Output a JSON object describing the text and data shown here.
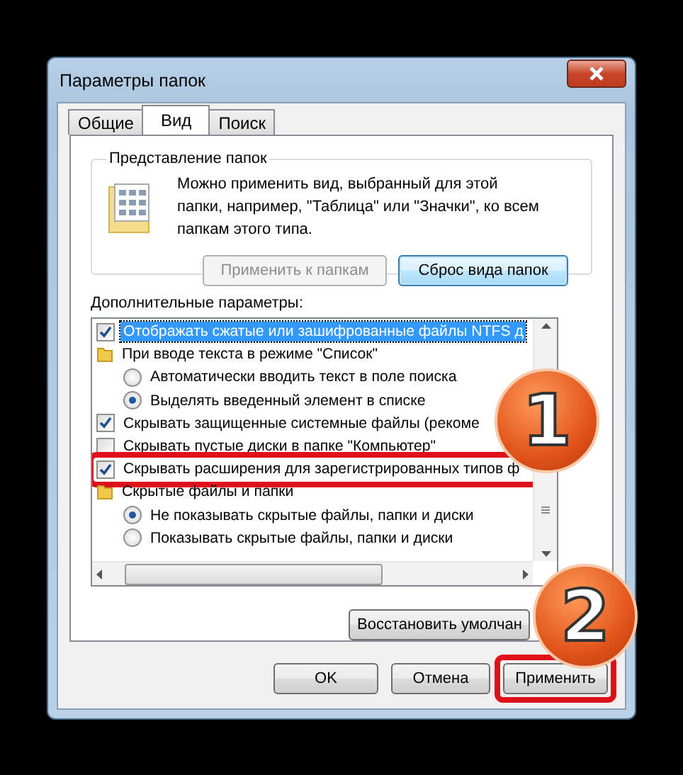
{
  "window": {
    "title": "Параметры папок"
  },
  "tabs": [
    {
      "label": "Общие",
      "selected": false
    },
    {
      "label": "Вид",
      "selected": true
    },
    {
      "label": "Поиск",
      "selected": false
    }
  ],
  "folder_views": {
    "title": "Представление папок",
    "description": "Можно применить вид, выбранный для этой папки, например, \"Таблица\" или \"Значки\", ко всем папкам этого типа.",
    "buttons": [
      {
        "label": "Применить к папкам",
        "disabled": true,
        "focused": false
      },
      {
        "label": "Сброс вида папок",
        "disabled": false,
        "focused": true
      }
    ]
  },
  "advanced": {
    "label": "Дополнительные параметры:",
    "items": [
      {
        "kind": "checkbox",
        "label": "Отображать сжатые или зашифрованные файлы NTFS д",
        "checked": true,
        "selected": true,
        "outlined": false
      },
      {
        "kind": "folder",
        "label": "При вводе текста в режиме \"Список\"",
        "selected": false,
        "outlined": false,
        "children": [
          {
            "kind": "radio",
            "label": "Автоматически вводить текст в поле поиска",
            "checked": false,
            "selected": false,
            "outlined": false
          },
          {
            "kind": "radio",
            "label": "Выделять введенный элемент в списке",
            "checked": true,
            "selected": false,
            "outlined": false
          }
        ]
      },
      {
        "kind": "checkbox",
        "label": "Скрывать защищенные системные файлы (рекоме",
        "checked": true,
        "selected": false,
        "outlined": false
      },
      {
        "kind": "checkbox",
        "label": "Скрывать пустые диски в папке \"Компьютер\"",
        "checked": false,
        "selected": false,
        "outlined": false
      },
      {
        "kind": "checkbox",
        "label": "Скрывать расширения для зарегистрированных типов ф",
        "checked": true,
        "selected": false,
        "outlined": true
      },
      {
        "kind": "folder",
        "label": "Скрытые файлы и папки",
        "selected": false,
        "outlined": false,
        "children": [
          {
            "kind": "radio",
            "label": "Не показывать скрытые файлы, папки и диски",
            "checked": true,
            "selected": false,
            "outlined": false
          },
          {
            "kind": "radio",
            "label": "Показывать скрытые файлы, папки и диски",
            "checked": false,
            "selected": false,
            "outlined": false
          }
        ]
      }
    ]
  },
  "restore_button": {
    "label": "Восстановить умолчан"
  },
  "buttons": [
    {
      "label": "OK",
      "outlined": false
    },
    {
      "label": "Отмена",
      "outlined": false
    },
    {
      "label": "Применить",
      "outlined": true
    }
  ],
  "annotations": [
    {
      "kind": "badge",
      "label": "1"
    },
    {
      "kind": "badge",
      "label": "2"
    }
  ]
}
